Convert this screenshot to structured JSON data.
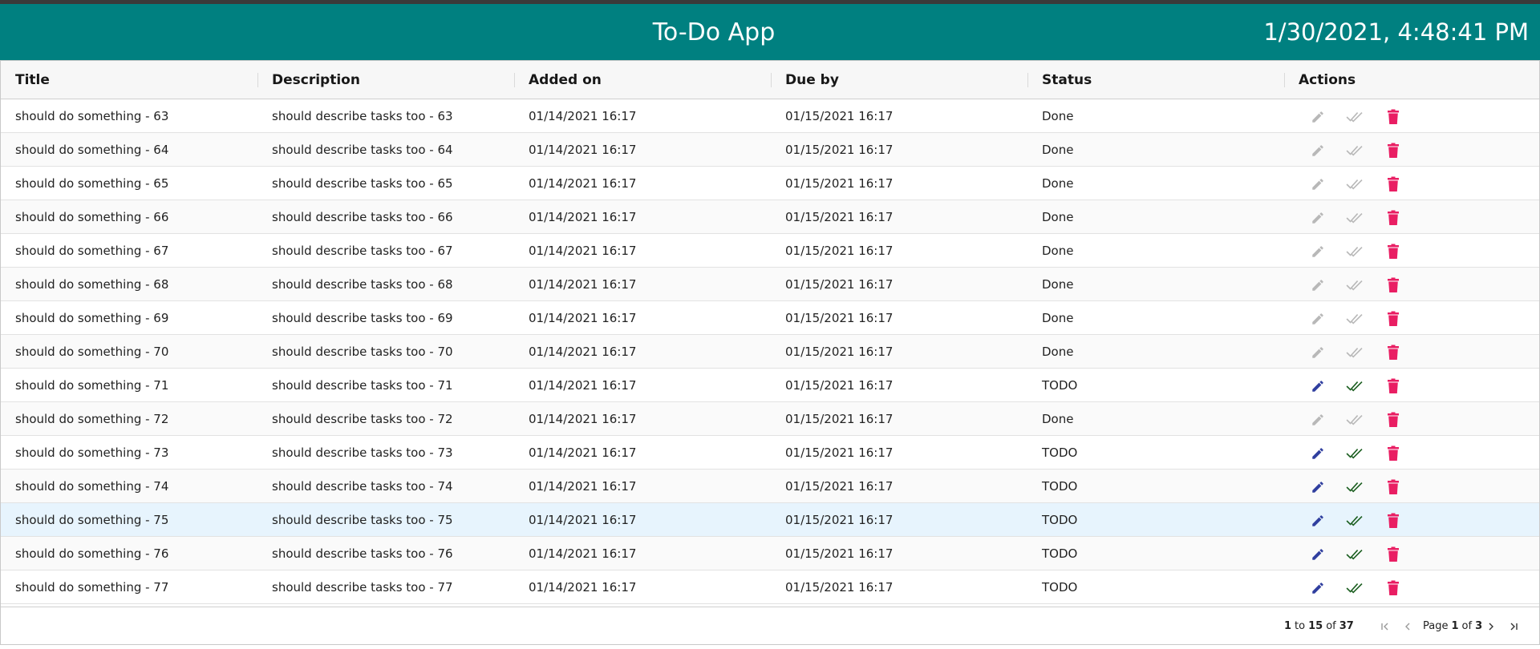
{
  "app": {
    "title": "To-Do App",
    "clock": "1/30/2021, 4:48:41 PM",
    "colors": {
      "appbar": "#008080",
      "edit": "#303f9f",
      "done": "#1b5e20",
      "delete": "#e91e63",
      "disabled": "#b8b8b8"
    }
  },
  "table": {
    "columns": [
      "Title",
      "Description",
      "Added on",
      "Due by",
      "Status",
      "Actions"
    ],
    "rows": [
      {
        "title": "should do something - 63",
        "description": "should describe tasks too - 63",
        "added": "01/14/2021 16:17",
        "due": "01/15/2021 16:17",
        "status": "Done"
      },
      {
        "title": "should do something - 64",
        "description": "should describe tasks too - 64",
        "added": "01/14/2021 16:17",
        "due": "01/15/2021 16:17",
        "status": "Done"
      },
      {
        "title": "should do something - 65",
        "description": "should describe tasks too - 65",
        "added": "01/14/2021 16:17",
        "due": "01/15/2021 16:17",
        "status": "Done"
      },
      {
        "title": "should do something - 66",
        "description": "should describe tasks too - 66",
        "added": "01/14/2021 16:17",
        "due": "01/15/2021 16:17",
        "status": "Done"
      },
      {
        "title": "should do something - 67",
        "description": "should describe tasks too - 67",
        "added": "01/14/2021 16:17",
        "due": "01/15/2021 16:17",
        "status": "Done"
      },
      {
        "title": "should do something - 68",
        "description": "should describe tasks too - 68",
        "added": "01/14/2021 16:17",
        "due": "01/15/2021 16:17",
        "status": "Done"
      },
      {
        "title": "should do something - 69",
        "description": "should describe tasks too - 69",
        "added": "01/14/2021 16:17",
        "due": "01/15/2021 16:17",
        "status": "Done"
      },
      {
        "title": "should do something - 70",
        "description": "should describe tasks too - 70",
        "added": "01/14/2021 16:17",
        "due": "01/15/2021 16:17",
        "status": "Done"
      },
      {
        "title": "should do something - 71",
        "description": "should describe tasks too - 71",
        "added": "01/14/2021 16:17",
        "due": "01/15/2021 16:17",
        "status": "TODO"
      },
      {
        "title": "should do something - 72",
        "description": "should describe tasks too - 72",
        "added": "01/14/2021 16:17",
        "due": "01/15/2021 16:17",
        "status": "Done"
      },
      {
        "title": "should do something - 73",
        "description": "should describe tasks too - 73",
        "added": "01/14/2021 16:17",
        "due": "01/15/2021 16:17",
        "status": "TODO"
      },
      {
        "title": "should do something - 74",
        "description": "should describe tasks too - 74",
        "added": "01/14/2021 16:17",
        "due": "01/15/2021 16:17",
        "status": "TODO"
      },
      {
        "title": "should do something - 75",
        "description": "should describe tasks too - 75",
        "added": "01/14/2021 16:17",
        "due": "01/15/2021 16:17",
        "status": "TODO"
      },
      {
        "title": "should do something - 76",
        "description": "should describe tasks too - 76",
        "added": "01/14/2021 16:17",
        "due": "01/15/2021 16:17",
        "status": "TODO"
      },
      {
        "title": "should do something - 77",
        "description": "should describe tasks too - 77",
        "added": "01/14/2021 16:17",
        "due": "01/15/2021 16:17",
        "status": "TODO"
      }
    ],
    "action_icons": [
      "pencil-icon",
      "double-check-icon",
      "trash-icon"
    ]
  },
  "pager": {
    "from": "1",
    "to_word": "to",
    "to": "15",
    "of_word": "of",
    "total": "37",
    "page_word": "Page",
    "page": "1",
    "page_of": "of",
    "page_count": "3",
    "icons": [
      "first-page-icon",
      "previous-page-icon",
      "next-page-icon",
      "last-page-icon"
    ]
  }
}
